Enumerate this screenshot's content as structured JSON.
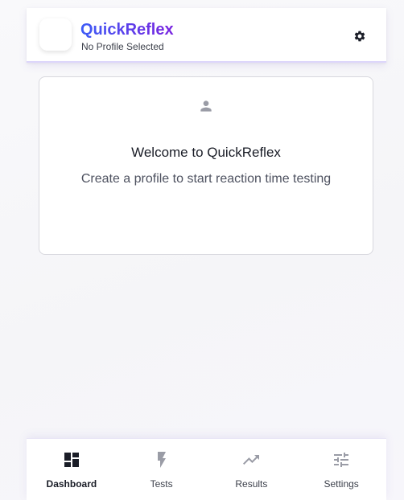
{
  "header": {
    "app_title": "QuickReflex",
    "profile_status": "No Profile Selected",
    "settings_icon": "gear-icon"
  },
  "welcome": {
    "icon": "person-icon",
    "title": "Welcome to QuickReflex",
    "subtitle": "Create a profile to start reaction time testing"
  },
  "nav": {
    "active": "Dashboard",
    "items": [
      {
        "label": "Dashboard",
        "icon": "dashboard-icon"
      },
      {
        "label": "Tests",
        "icon": "bolt-icon"
      },
      {
        "label": "Results",
        "icon": "trending-up-icon"
      },
      {
        "label": "Settings",
        "icon": "tune-icon"
      }
    ]
  },
  "colors": {
    "brand_gradient_start": "#3d5cf6",
    "brand_gradient_end": "#7a24e0",
    "active_icon": "#1a1d27",
    "inactive_icon": "#9a9ca6",
    "accent_border": "#ddd6fb"
  }
}
